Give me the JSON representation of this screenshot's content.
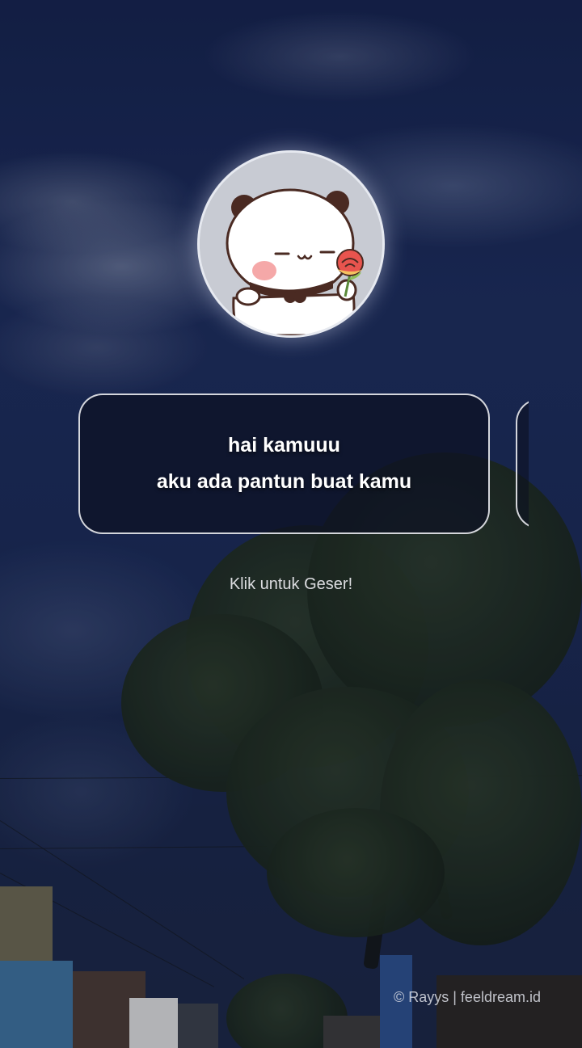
{
  "card": {
    "lines": [
      "hai kamuuu",
      "aku ada pantun buat kamu"
    ]
  },
  "hint": {
    "label": "Klik untuk Geser!"
  },
  "footer": {
    "credit": "© Rayys | feeldream.id"
  },
  "avatar": {
    "icon": "panda-with-rose-icon"
  },
  "colors": {
    "card_border": "#ebebf0",
    "card_background": "#0c1022",
    "avatar_background": "#c8cbd3",
    "text": "#ffffff"
  }
}
